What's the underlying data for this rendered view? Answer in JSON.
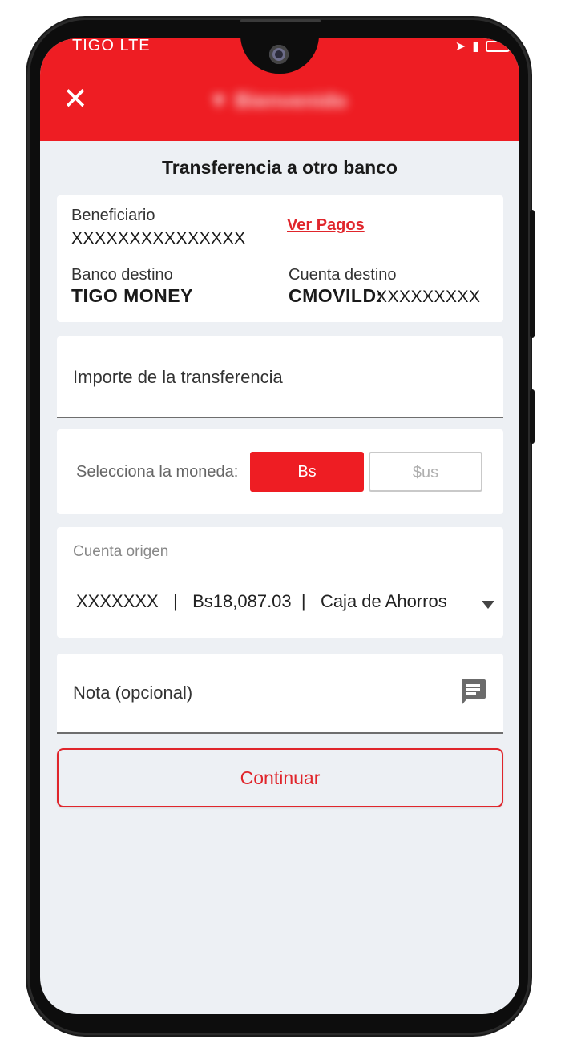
{
  "status_bar": {
    "carrier": "TIGO  LTE"
  },
  "header": {
    "close_icon": "close-icon",
    "logo_text": "▼ Bienvenido"
  },
  "page_title": "Transferencia a otro banco",
  "beneficiary_card": {
    "beneficiario_label": "Beneficiario",
    "beneficiario_value": "XXXXXXXXXXXXXXX",
    "ver_pagos_label": "Ver Pagos",
    "banco_destino_label": "Banco destino",
    "banco_destino_value": "TIGO MONEY",
    "cuenta_destino_label": "Cuenta destino",
    "cuenta_destino_prefix": "CMOVILD:",
    "cuenta_destino_value": "XXXXXXXXX"
  },
  "importe": {
    "placeholder": "Importe de la transferencia"
  },
  "moneda": {
    "label": "Selecciona la moneda:",
    "options": [
      "Bs",
      "$us"
    ],
    "selected": "Bs"
  },
  "cuenta_origen": {
    "label": "Cuenta origen",
    "account_number": "XXXXXXX",
    "balance": "Bs18,087.03",
    "account_type": "Caja de Ahorros"
  },
  "nota": {
    "placeholder": "Nota (opcional)",
    "icon": "message-icon"
  },
  "continue_label": "Continuar",
  "colors": {
    "brand_red": "#ee1d23",
    "link_red": "#e0252b",
    "background": "#edf0f4"
  }
}
